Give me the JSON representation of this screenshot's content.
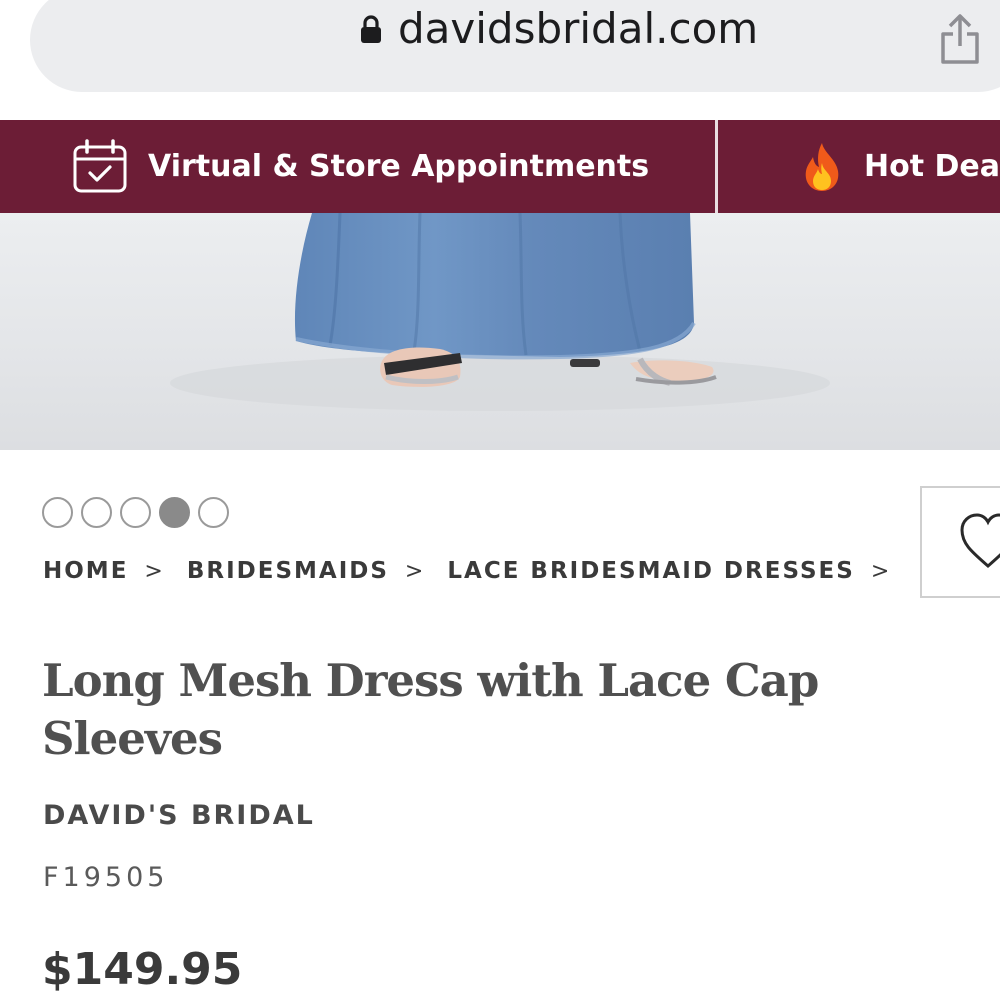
{
  "browser": {
    "url": "davidsbridal.com",
    "lock_icon": "lock-icon",
    "share_icon": "share-icon"
  },
  "promo_bar": {
    "background": "#6c1d36",
    "items": [
      {
        "label": "Virtual & Store Appointments",
        "icon": "calendar-check-icon"
      },
      {
        "label": "Hot Deals",
        "icon": "fire-icon"
      }
    ]
  },
  "gallery": {
    "image_count": 5,
    "active_index": 3
  },
  "wishlist": {
    "icon": "heart-icon"
  },
  "breadcrumb": [
    {
      "label": "HOME"
    },
    {
      "label": "BRIDESMAIDS"
    },
    {
      "label": "LACE BRIDESMAID DRESSES"
    }
  ],
  "breadcrumb_separator": ">",
  "product": {
    "title": "Long Mesh Dress with Lace Cap Sleeves",
    "brand": "DAVID'S BRIDAL",
    "sku": "F19505",
    "price": "$149.95"
  }
}
